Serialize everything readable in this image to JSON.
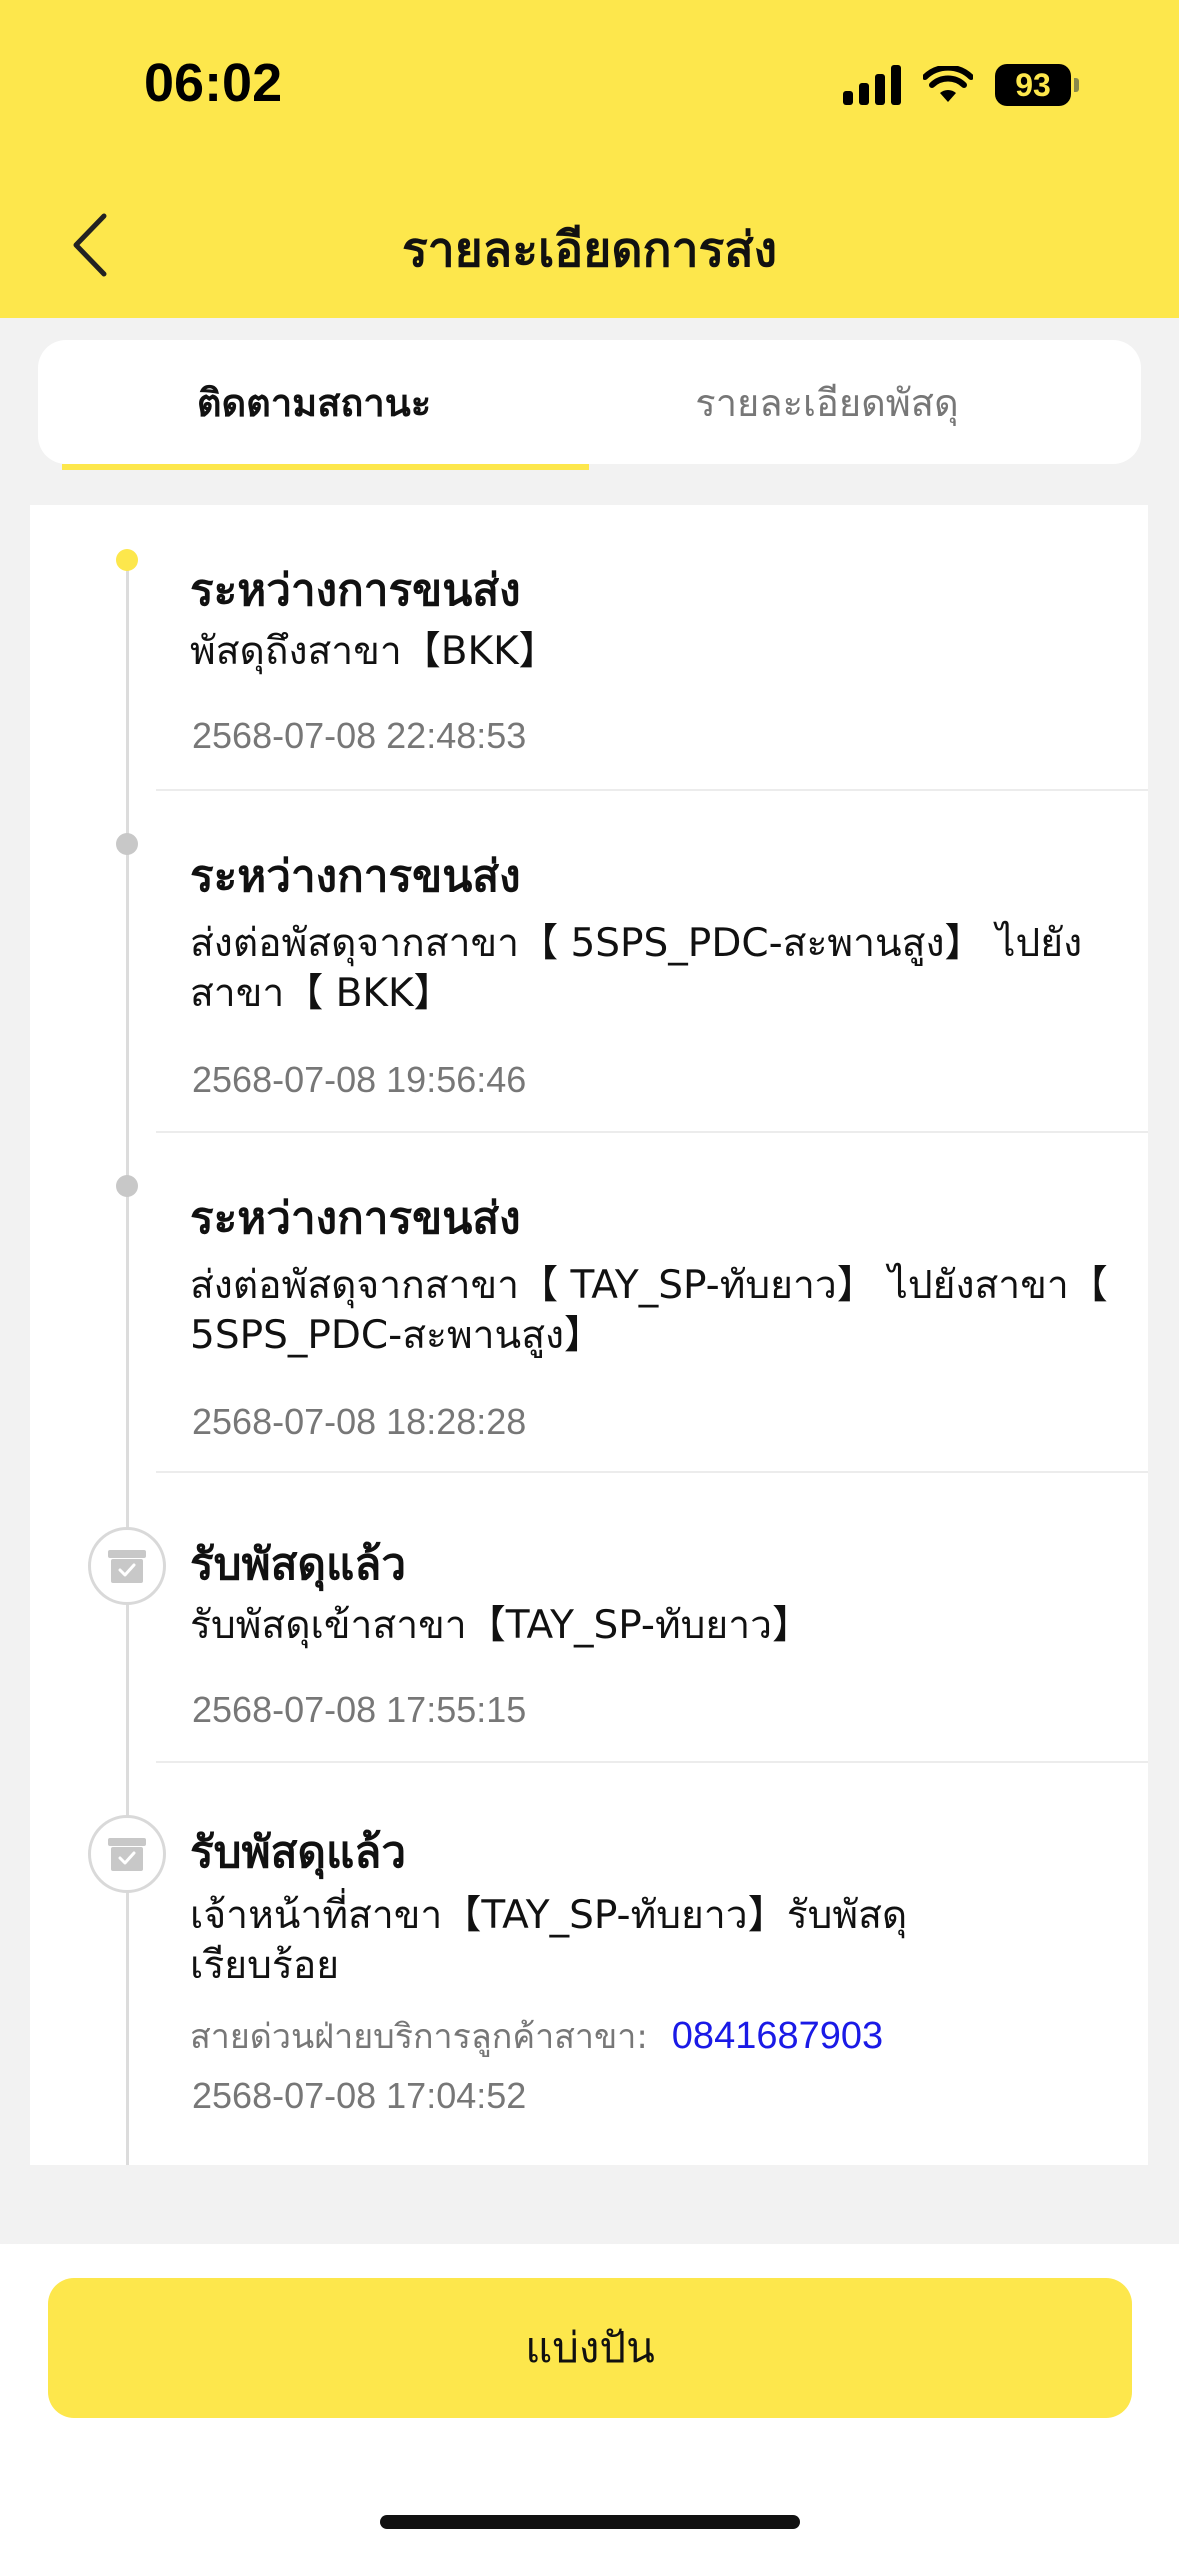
{
  "status_bar": {
    "time": "06:02",
    "battery": "93",
    "icons": [
      "signal-icon",
      "wifi-icon",
      "battery-icon"
    ]
  },
  "header": {
    "title": "รายละเอียดการส่ง",
    "back_icon": "chevron-left-icon"
  },
  "tabs": [
    {
      "label": "ติดตามสถานะ",
      "active": true
    },
    {
      "label": "รายละเอียดพัสดุ",
      "active": false
    }
  ],
  "timeline": [
    {
      "title": "ระหว่างการขนส่ง",
      "desc": "พัสดุถึงสาขา【BKK】",
      "time": "2568-07-08 22:48:53",
      "marker": "dot-active"
    },
    {
      "title": "ระหว่างการขนส่ง",
      "desc": "ส่งต่อพัสดุจากสาขา【 5SPS_PDC-สะพานสูง】 ไปยังสาขา【 BKK】",
      "time": "2568-07-08 19:56:46",
      "marker": "dot"
    },
    {
      "title": "ระหว่างการขนส่ง",
      "desc": "ส่งต่อพัสดุจากสาขา【 TAY_SP-ทับยาว】 ไปยังสาขา【 5SPS_PDC-สะพานสูง】",
      "time": "2568-07-08 18:28:28",
      "marker": "dot"
    },
    {
      "title": "รับพัสดุแล้ว",
      "desc": "รับพัสดุเข้าสาขา【TAY_SP-ทับยาว】",
      "time": "2568-07-08 17:55:15",
      "marker": "parcel-icon"
    },
    {
      "title": "รับพัสดุแล้ว",
      "desc": "เจ้าหน้าที่สาขา【TAY_SP-ทับยาว】รับพัสดุเรียบร้อย",
      "hotline_label": "สายด่วนฝ่ายบริการลูกค้าสาขา:",
      "hotline_phone": "0841687903",
      "time": "2568-07-08 17:04:52",
      "marker": "parcel-icon"
    }
  ],
  "footer": {
    "share_label": "แบ่งปัน"
  },
  "colors": {
    "brand_yellow": "#fde74c",
    "link_blue": "#1a1ae6",
    "muted_gray": "#777777"
  }
}
